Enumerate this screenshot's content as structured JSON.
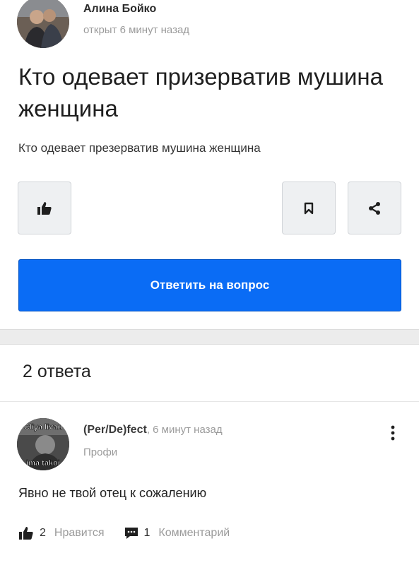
{
  "question": {
    "author": "Алина Бойко",
    "time": "открыт 6 минут назад",
    "title": "Кто одевает призерватив мушина женщина",
    "body": "Кто одевает презерватив мушина женщина",
    "answer_button": "Ответить на вопрос",
    "icons": [
      "thumbs-up-icon",
      "bookmark-icon",
      "share-icon"
    ]
  },
  "answers": {
    "count_label": "2 ответа",
    "items": [
      {
        "author": "(Per/De)fect",
        "time": ", 6 минут назад",
        "rank": "Профи",
        "text": "Явно не твой отец к сожалению",
        "likes": "2",
        "likes_label": "Нравится",
        "comments": "1",
        "comments_label": "Комментарий",
        "avatar_caption_top": "Cliya livau",
        "avatar_caption_bottom": "ima takoi"
      }
    ]
  },
  "colors": {
    "accent": "#0a6cf5",
    "muted": "#9a9a9a",
    "button_bg": "#eef0f2"
  }
}
